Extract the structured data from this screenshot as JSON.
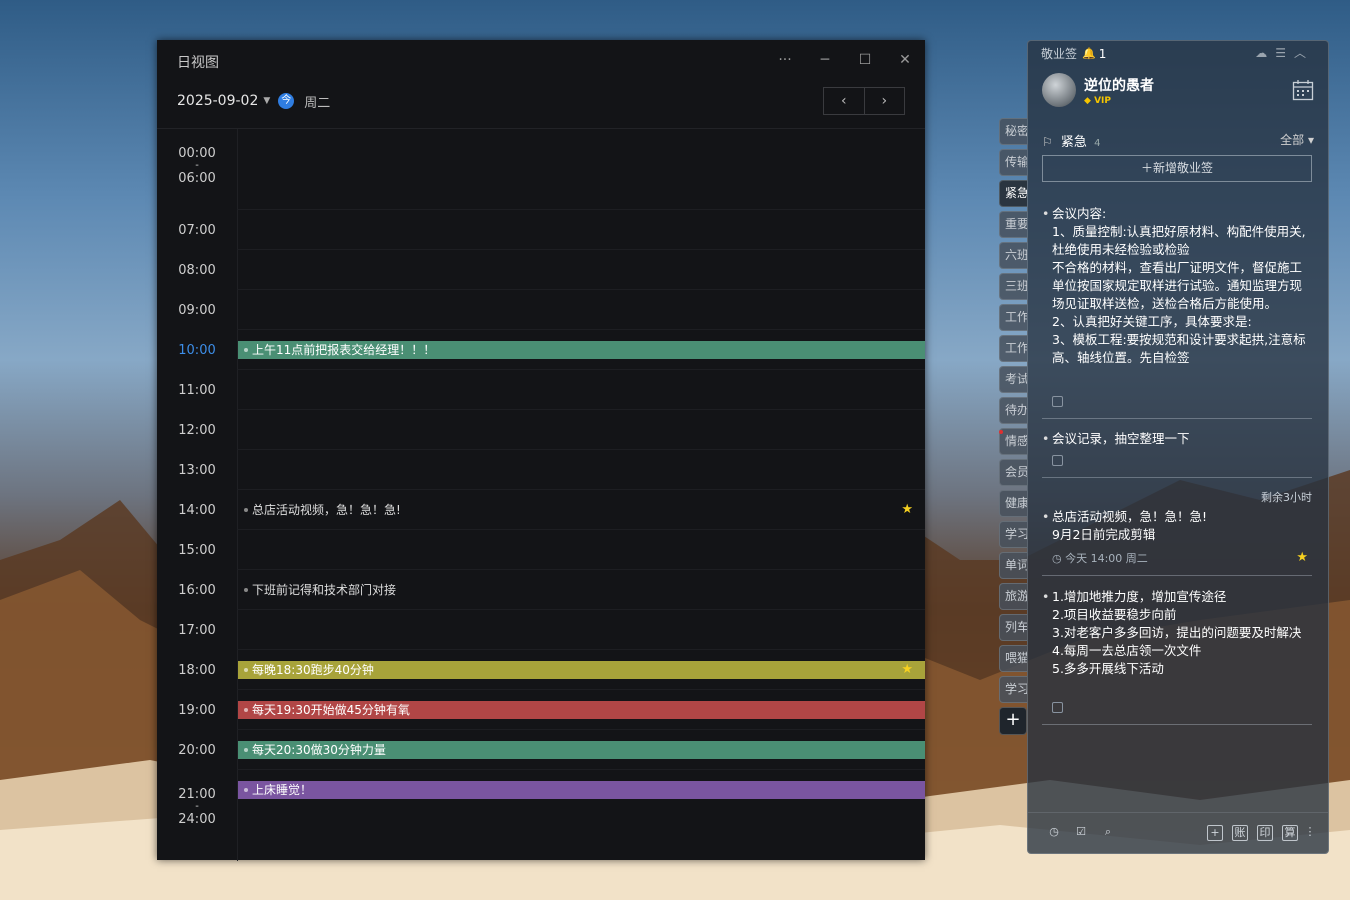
{
  "day_view": {
    "title": "日视图",
    "date": "2025-09-02",
    "today_badge": "今",
    "weekday": "周二",
    "controls": {
      "more": "···",
      "minimize": "─",
      "maximize": "☐",
      "close": "✕"
    },
    "nav": {
      "prev": "‹",
      "next": "›"
    },
    "times": {
      "range_start": [
        "00:00",
        "-",
        "06:00"
      ],
      "hours": [
        "07:00",
        "08:00",
        "09:00",
        "10:00",
        "11:00",
        "12:00",
        "13:00",
        "14:00",
        "15:00",
        "16:00",
        "17:00",
        "18:00",
        "19:00",
        "20:00"
      ],
      "range_end": [
        "21:00",
        "-",
        "24:00"
      ]
    },
    "events": [
      {
        "text": "上午11点前把报表交给经理！！！",
        "color": "#4a8f74"
      },
      {
        "text": "总店活动视频，急！急！急!"
      },
      {
        "text": "下班前记得和技术部门对接"
      },
      {
        "text": "每晚18:30跑步40分钟",
        "color": "#a8a33a"
      },
      {
        "text": "每天19:30开始做45分钟有氧",
        "color": "#b14646"
      },
      {
        "text": "每天20:30做30分钟力量",
        "color": "#4a8f74"
      },
      {
        "text": "上床睡觉！",
        "color": "#7a55a0"
      }
    ]
  },
  "side_tabs": [
    "秘密",
    "传输",
    "紧急",
    "重要",
    "六班",
    "三班",
    "工作",
    "工作",
    "考试",
    "待办",
    "情感",
    "会员",
    "健康",
    "学习",
    "单词",
    "旅游",
    "列车",
    "喂猫",
    "学习"
  ],
  "side_add": "+",
  "note_panel": {
    "app_name": "敬业签",
    "notification_count": "1",
    "user": {
      "name": "逆位的愚者",
      "vip": "VIP"
    },
    "category": {
      "name": "紧急",
      "count": "4",
      "filter": "全部 ▾"
    },
    "add_button": "＋新增敬业签",
    "notes": [
      {
        "text": "会议内容:\n1、质量控制:认真把好原材料、构配件使用关,杜绝使用未经检验或检验\n不合格的材料，查看出厂证明文件，督促施工单位按国家规定取样进行试验。通知监理方现场见证取样送检，送检合格后方能使用。\n2、认真把好关键工序，具体要求是:\n3、模板工程:要按规范和设计要求起拱,注意标高、轴线位置。先自检签"
      },
      {
        "text": "会议记录，抽空整理一下"
      },
      {
        "text": "总店活动视频，急！急！急!\n9月2日前完成剪辑",
        "remaining": "剩余3小时",
        "meta": "今天 14:00 周二"
      },
      {
        "text": "1.增加地推力度，增加宣传途径\n2.项目收益要稳步向前\n3.对老客户多多回访，提出的问题要及时解决\n4.每周一去总店领一次文件\n5.多多开展线下活动"
      }
    ],
    "bottom_boxes": [
      "+",
      "账",
      "印",
      "算"
    ]
  }
}
